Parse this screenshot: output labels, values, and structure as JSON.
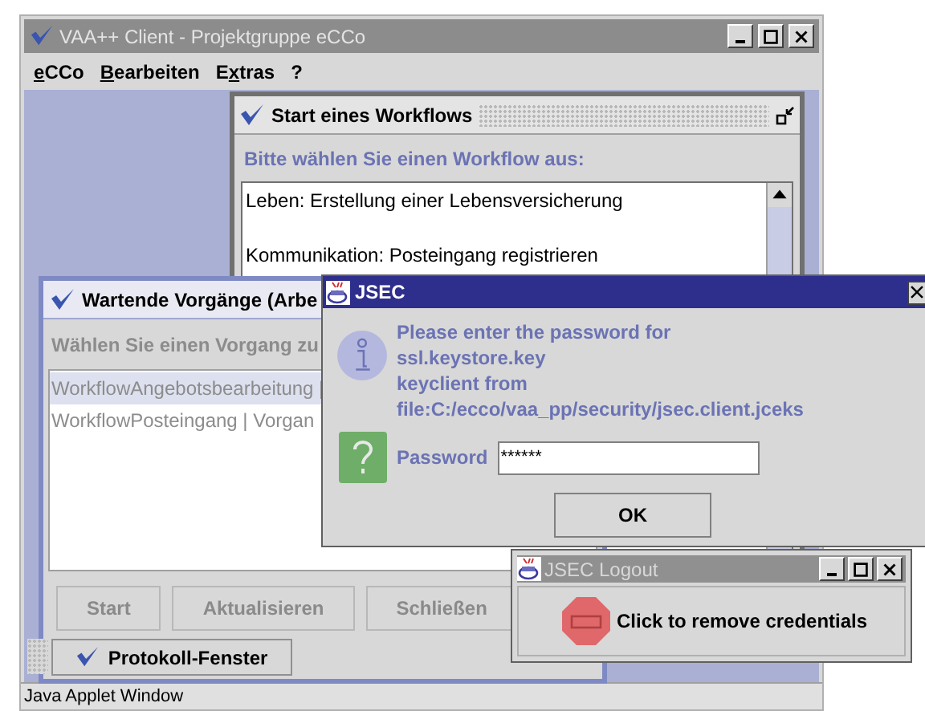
{
  "main_window": {
    "title": "VAA++ Client - Projektgruppe eCCo",
    "menu": [
      {
        "key": "e",
        "post": "CCo"
      },
      {
        "key": "B",
        "post": "earbeiten"
      },
      {
        "pre": "E",
        "key": "x",
        "post": "tras"
      },
      {
        "pre": "?"
      }
    ],
    "status_bar": "Java Applet Window"
  },
  "workflow_frame": {
    "title": "Start eines Workflows",
    "prompt": "Bitte wählen Sie einen Workflow aus:",
    "items": [
      "Leben: Erstellung einer Lebensversicherung",
      "Kommunikation: Posteingang registrieren"
    ]
  },
  "waiting_frame": {
    "title": "Wartende Vorgänge (Arbe",
    "prompt": "Wählen Sie einen Vorgang zu",
    "items": [
      {
        "label": "WorkflowAngebotsbearbeitung |",
        "selected": true
      },
      {
        "label": "WorkflowPosteingang | Vorgan",
        "selected": false
      }
    ],
    "buttons": [
      {
        "label": "Start",
        "disabled": true
      },
      {
        "label": "Aktualisieren",
        "disabled": true
      },
      {
        "label": "Schließen",
        "disabled": true
      }
    ]
  },
  "taskbar": {
    "label": "Protokoll-Fenster"
  },
  "password_dialog": {
    "title": "JSEC",
    "message": [
      "Please enter the password for",
      "ssl.keystore.key",
      "keyclient from file:C:/ecco/vaa_pp/security/jsec.client.jceks"
    ],
    "field_label": "Password",
    "value": "******",
    "ok": "OK"
  },
  "logout_window": {
    "title": "JSEC Logout",
    "message": "Click to remove credentials"
  }
}
